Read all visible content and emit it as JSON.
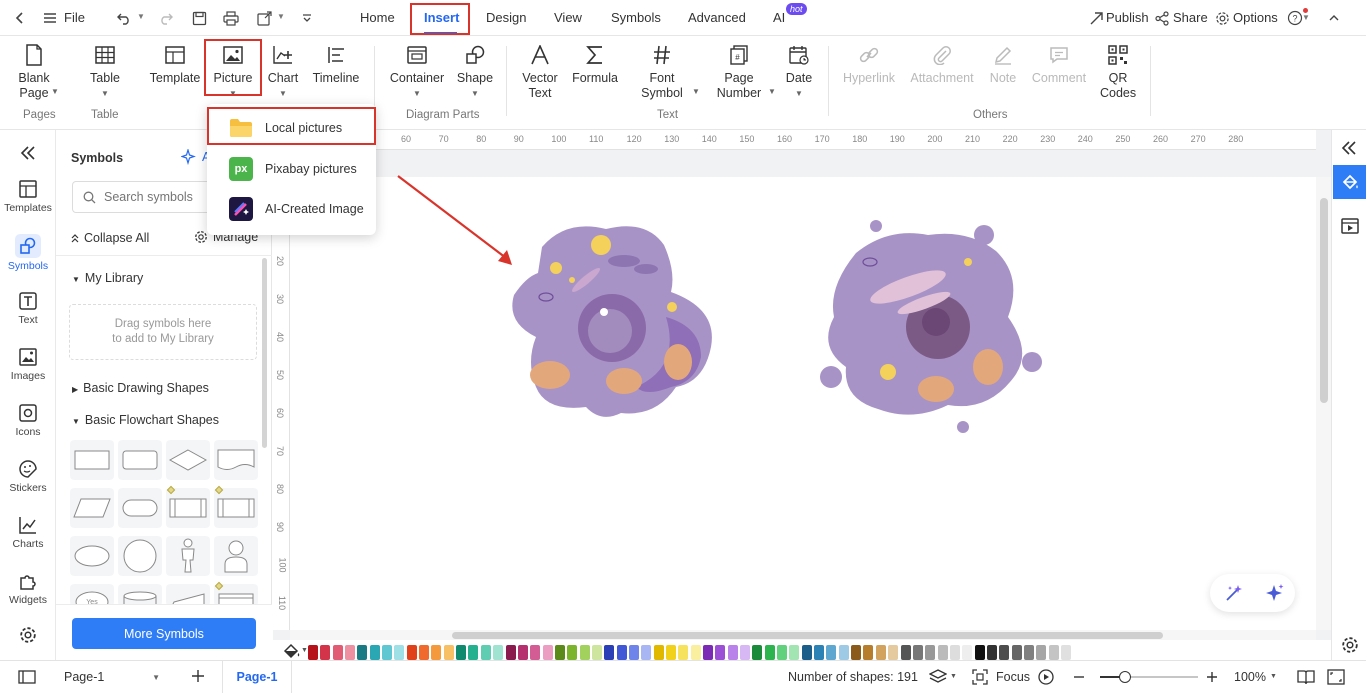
{
  "titlebar": {
    "file_label": "File",
    "tabs": [
      {
        "label": "Home"
      },
      {
        "label": "Insert"
      },
      {
        "label": "Design"
      },
      {
        "label": "View"
      },
      {
        "label": "Symbols"
      },
      {
        "label": "Advanced"
      },
      {
        "label": "AI"
      }
    ],
    "ai_badge": "hot",
    "publish_label": "Publish",
    "share_label": "Share",
    "options_label": "Options"
  },
  "ribbon": {
    "buttons": {
      "blank_page": "Blank Page",
      "table": "Table",
      "template": "Template",
      "picture": "Picture",
      "chart": "Chart",
      "timeline": "Timeline",
      "container": "Container",
      "shape": "Shape",
      "vector_text": "Vector Text",
      "formula": "Formula",
      "font_symbol": "Font Symbol",
      "page_number": "Page Number",
      "date": "Date",
      "hyperlink": "Hyperlink",
      "attachment": "Attachment",
      "note": "Note",
      "comment": "Comment",
      "qr_codes": "QR Codes"
    },
    "groups": {
      "pages": "Pages",
      "table": "Table",
      "diagram_parts": "Diagram Parts",
      "text": "Text",
      "others": "Others"
    }
  },
  "picture_menu": {
    "items": [
      {
        "label": "Local pictures"
      },
      {
        "label": "Pixabay pictures"
      },
      {
        "label": "AI-Created Image"
      }
    ],
    "pixabay_badge": "px"
  },
  "leftbar": {
    "items": [
      {
        "label": "Templates"
      },
      {
        "label": "Symbols"
      },
      {
        "label": "Text"
      },
      {
        "label": "Images"
      },
      {
        "label": "Icons"
      },
      {
        "label": "Stickers"
      },
      {
        "label": "Charts"
      },
      {
        "label": "Widgets"
      }
    ]
  },
  "symbols_panel": {
    "title": "Symbols",
    "ai_label": "A",
    "search_placeholder": "Search symbols",
    "collapse_all": "Collapse All",
    "manage": "Manage",
    "my_library": "My Library",
    "library_hint_1": "Drag symbols here",
    "library_hint_2": "to add to My Library",
    "basic_drawing": "Basic Drawing Shapes",
    "basic_flowchart": "Basic Flowchart Shapes",
    "yes_label": "Yes",
    "more_symbols": "More Symbols"
  },
  "ruler": {
    "top_ticks": [
      "60",
      "70",
      "80",
      "90",
      "100",
      "110",
      "120",
      "130",
      "140",
      "150",
      "160",
      "170",
      "180",
      "190",
      "200",
      "210",
      "220",
      "230",
      "240",
      "250",
      "260",
      "270",
      "280"
    ],
    "left_ticks": [
      "20",
      "30",
      "40",
      "50",
      "60",
      "70",
      "80",
      "90",
      "100",
      "110"
    ]
  },
  "palette_colors": [
    "#b5121b",
    "#d4344a",
    "#e25b74",
    "#ef8fa2",
    "#1b7b85",
    "#2aa7b3",
    "#5fc7d2",
    "#9ee0e6",
    "#e0411b",
    "#ef6a2c",
    "#f59a3c",
    "#f7c066",
    "#0f8a6f",
    "#25b08f",
    "#5fcdb2",
    "#9fe3d0",
    "#8a1b4f",
    "#b5306f",
    "#d35c95",
    "#ec9dc2",
    "#5b8a1b",
    "#7cb52c",
    "#a3d15e",
    "#cde59f",
    "#2a3fb5",
    "#4058d6",
    "#6e84ea",
    "#a8b6f4",
    "#e0b800",
    "#f2d11b",
    "#f7e25e",
    "#faee9f",
    "#7a2ab5",
    "#9b4fd6",
    "#b982ea",
    "#d7b7f4",
    "#1b8a3a",
    "#2cb54e",
    "#62d17d",
    "#a2e5b2",
    "#1b5e8a",
    "#2c82b5",
    "#5ea7d1",
    "#9fcae5",
    "#8a5b1b",
    "#b57d2c",
    "#d1a35e",
    "#e5c99f",
    "#555555",
    "#777777",
    "#999999",
    "#bbbbbb",
    "#dddddd",
    "#eeeeee",
    "#111111",
    "#333333",
    "#4d4d4d",
    "#666666",
    "#808080",
    "#a6a6a6",
    "#c4c4c4",
    "#e0e0e0"
  ],
  "statusbar": {
    "page_select": "Page-1",
    "page_tab": "Page-1",
    "shape_count": "Number of shapes: 191",
    "focus": "Focus",
    "zoom": "100%"
  },
  "accent_color": "#2468f2",
  "highlight_color": "#d9342b"
}
